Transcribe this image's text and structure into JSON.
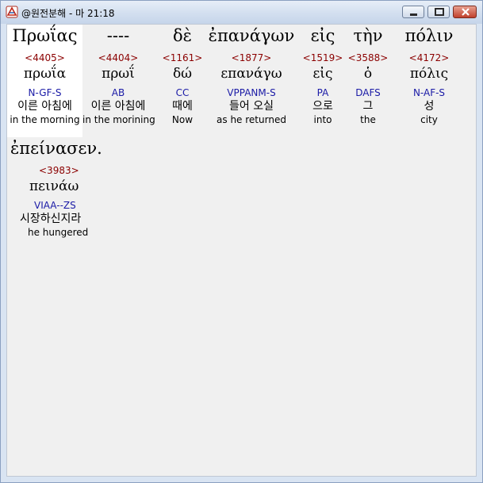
{
  "window": {
    "title": "@원전분해 - 마 21:18"
  },
  "words": [
    {
      "greek": "Πρωΐας",
      "strong": "<4405>",
      "lemma": "πρωΐα",
      "parse": "N-GF-S",
      "korean": "이른 아침에",
      "english": "in the morning"
    },
    {
      "greek": "----",
      "strong": "<4404>",
      "lemma": "πρωΐ",
      "parse": "AB",
      "korean": "이른 아침에",
      "english": "in the morining"
    },
    {
      "greek": "δὲ",
      "strong": "<1161>",
      "lemma": "δώ",
      "parse": "CC",
      "korean": "때에",
      "english": "Now"
    },
    {
      "greek": "ἐπανάγων",
      "strong": "<1877>",
      "lemma": "επανάγω",
      "parse": "VPPANM-S",
      "korean": "들어 오실",
      "english": "as he returned"
    },
    {
      "greek": "εἰς",
      "strong": "<1519>",
      "lemma": "εἰς",
      "parse": "PA",
      "korean": "으로",
      "english": "into"
    },
    {
      "greek": "τὴν",
      "strong": "<3588>",
      "lemma": "ὁ",
      "parse": "DAFS",
      "korean": "그",
      "english": "the"
    },
    {
      "greek": "πόλιν",
      "strong": "<4172>",
      "lemma": "πόλις",
      "parse": "N-AF-S",
      "korean": "성",
      "english": "city"
    },
    {
      "greek": "ἐπείνασεν.",
      "strong": "<3983>",
      "lemma": "πεινάω",
      "parse": "VIAA--ZS",
      "korean": "시장하신지라",
      "english": "he hungered"
    }
  ]
}
